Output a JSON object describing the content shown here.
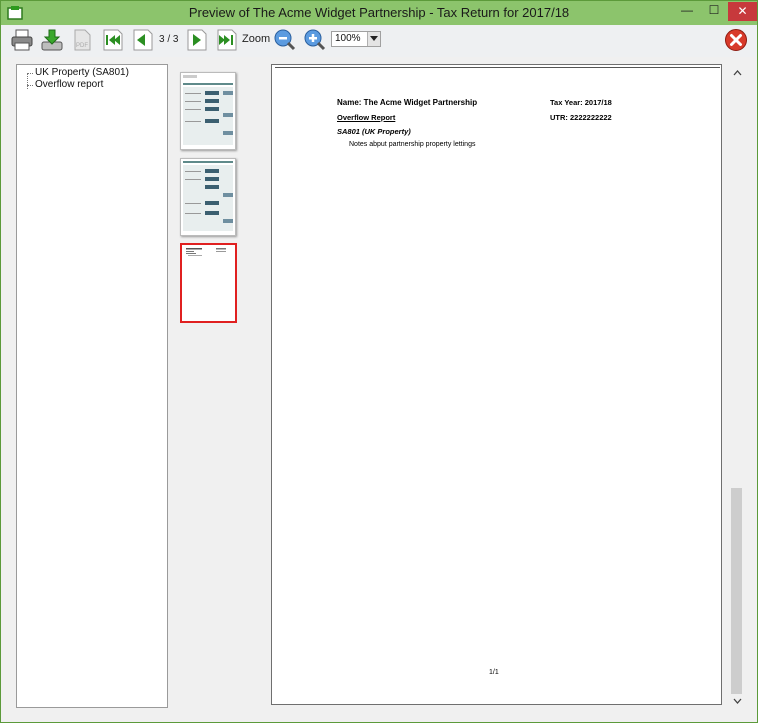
{
  "window": {
    "title": "Preview of The Acme Widget Partnership - Tax Return for 2017/18",
    "minimize_glyph": "—",
    "maximize_glyph": "☐",
    "close_glyph": "✕"
  },
  "toolbar": {
    "page_counter": "3 / 3",
    "zoom_label": "Zoom",
    "zoom_value": "100%",
    "icons": [
      "printer-icon",
      "save-download-icon",
      "pdf-icon",
      "first-page-icon",
      "previous-page-icon",
      "next-page-icon",
      "last-page-icon",
      "zoom-out-icon",
      "zoom-in-icon",
      "close-preview-icon"
    ]
  },
  "tree": {
    "items": [
      {
        "label": "UK Property (SA801)"
      },
      {
        "label": "Overflow report"
      }
    ]
  },
  "thumbnails": {
    "count": 3,
    "selected_index": 2
  },
  "document": {
    "name_line": "Name: The Acme Widget Partnership",
    "tax_year": "Tax Year: 2017/18",
    "overflow_report": "Overflow Report",
    "utr": "UTR: 2222222222",
    "section_title": "SA801 (UK Property)",
    "note": "Notes abput partnership property lettings",
    "page_number": "1/1"
  },
  "colors": {
    "titlebar": "#8cc46c",
    "close_button": "#c7393c",
    "selected_thumbnail": "#e02020"
  }
}
